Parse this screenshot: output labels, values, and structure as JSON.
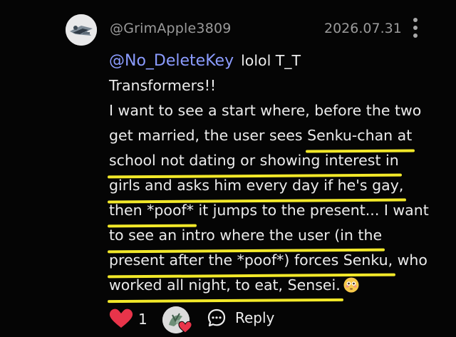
{
  "comment": {
    "username": "@GrimApple3809",
    "date": "2026.07.31",
    "mention": "@No_DeleteKey",
    "mention_suffix": "lolol T_T",
    "lines": {
      "l1": "Transformers!!",
      "l2": "I want to see a start where, before the two",
      "l3_plain": "get married, the user sees ",
      "l3_hl": "Senku-chan at",
      "l4_hl": "school not dating or showing interest in",
      "l5_hl": "girls and asks him every day if he's gay,",
      "l6_hl": "then *poof*",
      "l6_plain": " it jumps to the present... I want",
      "l7_hl": "to see an intro where the user (in the",
      "l8_hl": "present after the *poof*) forces Senku,",
      "l8_plain": " who",
      "l9_hl": "worked all night, to eat, Sensei."
    },
    "emoji": "flushed-face-emoji"
  },
  "actions": {
    "like_count": "1",
    "reply_label": "Reply"
  },
  "colors": {
    "background": "#050505",
    "mention": "#8b9cff",
    "highlight": "#f2e829",
    "heart": "#e8344a",
    "meta_text": "#9a9a9a"
  },
  "icons": {
    "more": "more-vertical-icon",
    "heart": "heart-icon",
    "reply": "comment-bubble-icon"
  }
}
